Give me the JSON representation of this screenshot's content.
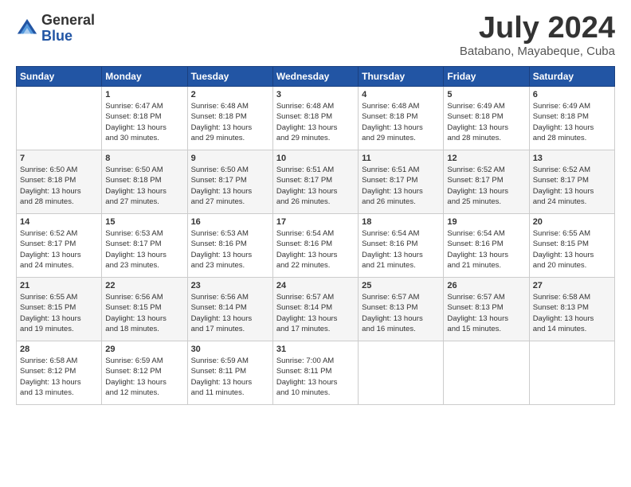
{
  "logo": {
    "general": "General",
    "blue": "Blue"
  },
  "title": "July 2024",
  "location": "Batabano, Mayabeque, Cuba",
  "days_header": [
    "Sunday",
    "Monday",
    "Tuesday",
    "Wednesday",
    "Thursday",
    "Friday",
    "Saturday"
  ],
  "weeks": [
    [
      {
        "day": "",
        "sunrise": "",
        "sunset": "",
        "daylight": ""
      },
      {
        "day": "1",
        "sunrise": "Sunrise: 6:47 AM",
        "sunset": "Sunset: 8:18 PM",
        "daylight": "Daylight: 13 hours and 30 minutes."
      },
      {
        "day": "2",
        "sunrise": "Sunrise: 6:48 AM",
        "sunset": "Sunset: 8:18 PM",
        "daylight": "Daylight: 13 hours and 29 minutes."
      },
      {
        "day": "3",
        "sunrise": "Sunrise: 6:48 AM",
        "sunset": "Sunset: 8:18 PM",
        "daylight": "Daylight: 13 hours and 29 minutes."
      },
      {
        "day": "4",
        "sunrise": "Sunrise: 6:48 AM",
        "sunset": "Sunset: 8:18 PM",
        "daylight": "Daylight: 13 hours and 29 minutes."
      },
      {
        "day": "5",
        "sunrise": "Sunrise: 6:49 AM",
        "sunset": "Sunset: 8:18 PM",
        "daylight": "Daylight: 13 hours and 28 minutes."
      },
      {
        "day": "6",
        "sunrise": "Sunrise: 6:49 AM",
        "sunset": "Sunset: 8:18 PM",
        "daylight": "Daylight: 13 hours and 28 minutes."
      }
    ],
    [
      {
        "day": "7",
        "sunrise": "Sunrise: 6:50 AM",
        "sunset": "Sunset: 8:18 PM",
        "daylight": "Daylight: 13 hours and 28 minutes."
      },
      {
        "day": "8",
        "sunrise": "Sunrise: 6:50 AM",
        "sunset": "Sunset: 8:18 PM",
        "daylight": "Daylight: 13 hours and 27 minutes."
      },
      {
        "day": "9",
        "sunrise": "Sunrise: 6:50 AM",
        "sunset": "Sunset: 8:17 PM",
        "daylight": "Daylight: 13 hours and 27 minutes."
      },
      {
        "day": "10",
        "sunrise": "Sunrise: 6:51 AM",
        "sunset": "Sunset: 8:17 PM",
        "daylight": "Daylight: 13 hours and 26 minutes."
      },
      {
        "day": "11",
        "sunrise": "Sunrise: 6:51 AM",
        "sunset": "Sunset: 8:17 PM",
        "daylight": "Daylight: 13 hours and 26 minutes."
      },
      {
        "day": "12",
        "sunrise": "Sunrise: 6:52 AM",
        "sunset": "Sunset: 8:17 PM",
        "daylight": "Daylight: 13 hours and 25 minutes."
      },
      {
        "day": "13",
        "sunrise": "Sunrise: 6:52 AM",
        "sunset": "Sunset: 8:17 PM",
        "daylight": "Daylight: 13 hours and 24 minutes."
      }
    ],
    [
      {
        "day": "14",
        "sunrise": "Sunrise: 6:52 AM",
        "sunset": "Sunset: 8:17 PM",
        "daylight": "Daylight: 13 hours and 24 minutes."
      },
      {
        "day": "15",
        "sunrise": "Sunrise: 6:53 AM",
        "sunset": "Sunset: 8:17 PM",
        "daylight": "Daylight: 13 hours and 23 minutes."
      },
      {
        "day": "16",
        "sunrise": "Sunrise: 6:53 AM",
        "sunset": "Sunset: 8:16 PM",
        "daylight": "Daylight: 13 hours and 23 minutes."
      },
      {
        "day": "17",
        "sunrise": "Sunrise: 6:54 AM",
        "sunset": "Sunset: 8:16 PM",
        "daylight": "Daylight: 13 hours and 22 minutes."
      },
      {
        "day": "18",
        "sunrise": "Sunrise: 6:54 AM",
        "sunset": "Sunset: 8:16 PM",
        "daylight": "Daylight: 13 hours and 21 minutes."
      },
      {
        "day": "19",
        "sunrise": "Sunrise: 6:54 AM",
        "sunset": "Sunset: 8:16 PM",
        "daylight": "Daylight: 13 hours and 21 minutes."
      },
      {
        "day": "20",
        "sunrise": "Sunrise: 6:55 AM",
        "sunset": "Sunset: 8:15 PM",
        "daylight": "Daylight: 13 hours and 20 minutes."
      }
    ],
    [
      {
        "day": "21",
        "sunrise": "Sunrise: 6:55 AM",
        "sunset": "Sunset: 8:15 PM",
        "daylight": "Daylight: 13 hours and 19 minutes."
      },
      {
        "day": "22",
        "sunrise": "Sunrise: 6:56 AM",
        "sunset": "Sunset: 8:15 PM",
        "daylight": "Daylight: 13 hours and 18 minutes."
      },
      {
        "day": "23",
        "sunrise": "Sunrise: 6:56 AM",
        "sunset": "Sunset: 8:14 PM",
        "daylight": "Daylight: 13 hours and 17 minutes."
      },
      {
        "day": "24",
        "sunrise": "Sunrise: 6:57 AM",
        "sunset": "Sunset: 8:14 PM",
        "daylight": "Daylight: 13 hours and 17 minutes."
      },
      {
        "day": "25",
        "sunrise": "Sunrise: 6:57 AM",
        "sunset": "Sunset: 8:13 PM",
        "daylight": "Daylight: 13 hours and 16 minutes."
      },
      {
        "day": "26",
        "sunrise": "Sunrise: 6:57 AM",
        "sunset": "Sunset: 8:13 PM",
        "daylight": "Daylight: 13 hours and 15 minutes."
      },
      {
        "day": "27",
        "sunrise": "Sunrise: 6:58 AM",
        "sunset": "Sunset: 8:13 PM",
        "daylight": "Daylight: 13 hours and 14 minutes."
      }
    ],
    [
      {
        "day": "28",
        "sunrise": "Sunrise: 6:58 AM",
        "sunset": "Sunset: 8:12 PM",
        "daylight": "Daylight: 13 hours and 13 minutes."
      },
      {
        "day": "29",
        "sunrise": "Sunrise: 6:59 AM",
        "sunset": "Sunset: 8:12 PM",
        "daylight": "Daylight: 13 hours and 12 minutes."
      },
      {
        "day": "30",
        "sunrise": "Sunrise: 6:59 AM",
        "sunset": "Sunset: 8:11 PM",
        "daylight": "Daylight: 13 hours and 11 minutes."
      },
      {
        "day": "31",
        "sunrise": "Sunrise: 7:00 AM",
        "sunset": "Sunset: 8:11 PM",
        "daylight": "Daylight: 13 hours and 10 minutes."
      },
      {
        "day": "",
        "sunrise": "",
        "sunset": "",
        "daylight": ""
      },
      {
        "day": "",
        "sunrise": "",
        "sunset": "",
        "daylight": ""
      },
      {
        "day": "",
        "sunrise": "",
        "sunset": "",
        "daylight": ""
      }
    ]
  ]
}
